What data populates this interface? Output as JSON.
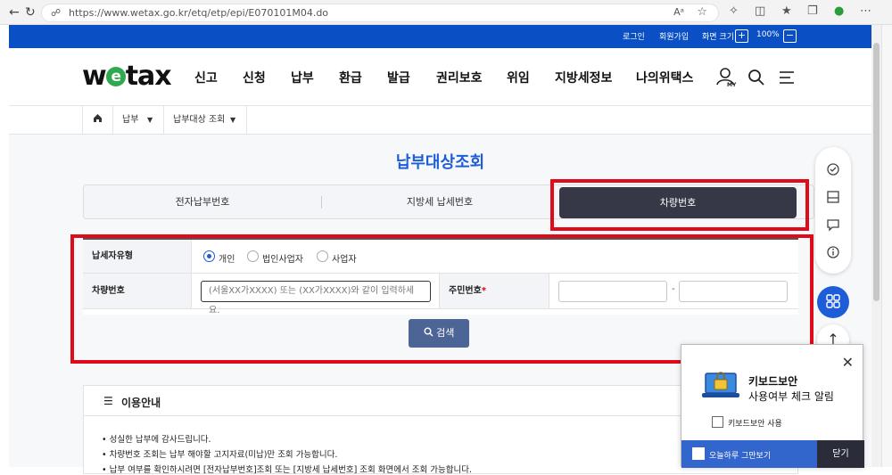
{
  "browser": {
    "url": "https://www.wetax.go.kr/etq/etp/epi/E070101M04.do",
    "reader_label": "Aᵃ"
  },
  "utilbar": {
    "login": "로그인",
    "join": "회원가입",
    "zoom_label": "화면 크기",
    "zoom_plus": "+",
    "zoom_value": "100%",
    "zoom_minus": "−"
  },
  "header": {
    "logo_left": "w",
    "logo_e": "e",
    "logo_right": "tax",
    "menu": [
      "신고",
      "신청",
      "납부",
      "환급",
      "발급",
      "권리보호",
      "위임",
      "지방세정보",
      "나의위택스"
    ],
    "my_label": "MY"
  },
  "breadcrumb": {
    "level1": "납부",
    "level2": "납부대상 조회"
  },
  "page": {
    "title": "납부대상조회"
  },
  "tabs": [
    {
      "label": "전자납부번호",
      "active": false
    },
    {
      "label": "지방세 납세번호",
      "active": false
    },
    {
      "label": "차량번호",
      "active": true
    }
  ],
  "form": {
    "taxpayer_type_label": "납세자유형",
    "options": [
      "개인",
      "법인사업자",
      "사업자"
    ],
    "selected_option": "개인",
    "vehicle_label": "차량번호",
    "vehicle_placeholder": "(서울XX가XXXX) 또는 (XX가XXXX)와 같이 입력하세요.",
    "rrn_label": "주민번호",
    "required_mark": "*",
    "rrn_separator": "-",
    "search_button": "검색"
  },
  "guide": {
    "title": "이용안내",
    "lines": [
      "• 성실한 납부에 감사드립니다.",
      "• 차량번호 조회는 납부 해야할 고지자료(미납)만 조회 가능합니다.",
      "• 납부 여부를 확인하시려면 [전자납부번호]조회 또는 [지방세 납세번호] 조회 화면에서 조회 가능합니다."
    ]
  },
  "keyboard_popup": {
    "title": "키보드보안",
    "subtitle": "사용여부 체크 알림",
    "checkbox_label": "키보드보안 사용",
    "dont_show_today": "오늘하루 그만보기",
    "close_button": "닫기"
  },
  "colors": {
    "brand_blue": "#1d5ed8",
    "util_blue": "#0a4fc4",
    "active_tab": "#363847",
    "search_btn": "#4d6497",
    "highlight_red": "#e00b1a",
    "logo_green": "#2fa84f"
  }
}
